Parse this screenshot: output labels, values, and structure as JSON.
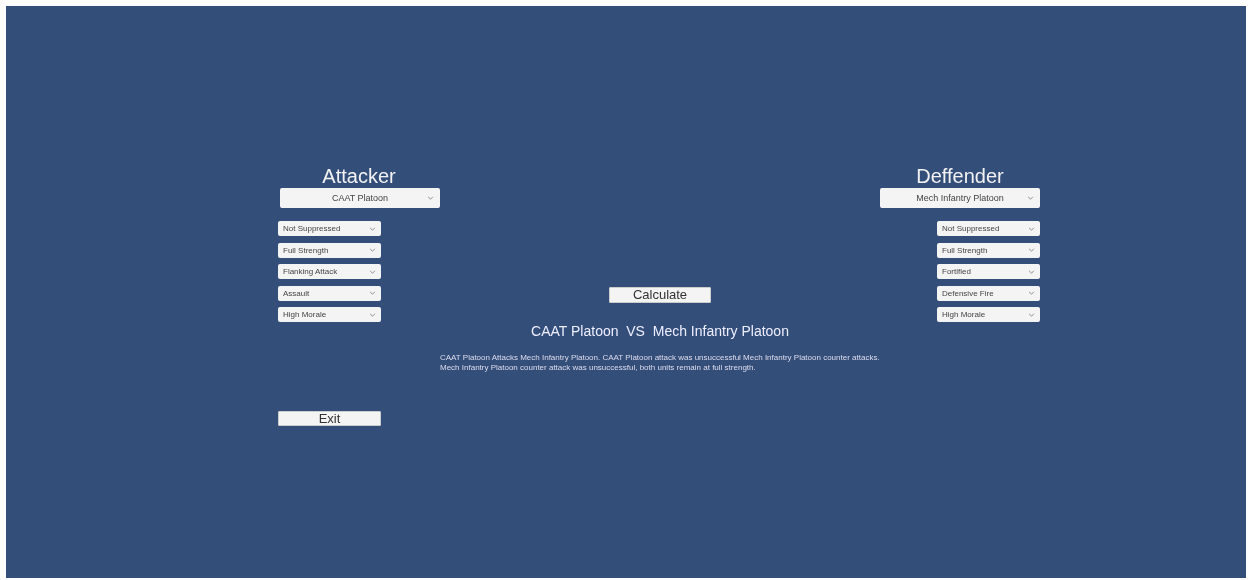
{
  "attacker": {
    "title": "Attacker",
    "unit": "CAAT Platoon",
    "modifiers": [
      "Not Suppressed",
      "Full Strength",
      "Flanking Attack",
      "Assault",
      "High Morale"
    ]
  },
  "defender": {
    "title": "Deffender",
    "unit": "Mech Infantry Platoon",
    "modifiers": [
      "Not Suppressed",
      "Full Strength",
      "Fortified",
      "Defensive Fire",
      "High Morale"
    ]
  },
  "calculate_button": "Calculate",
  "matchup": "CAAT Platoon  VS  Mech Infantry Platoon",
  "result": "CAAT Platoon Attacks Mech Infantry Platoon. CAAT Platoon attack was unsuccessful Mech Infantry Platoon counter attacks. Mech Infantry Platoon counter attack was unsuccessful, both units remain at full strength.",
  "exit_button": "Exit"
}
